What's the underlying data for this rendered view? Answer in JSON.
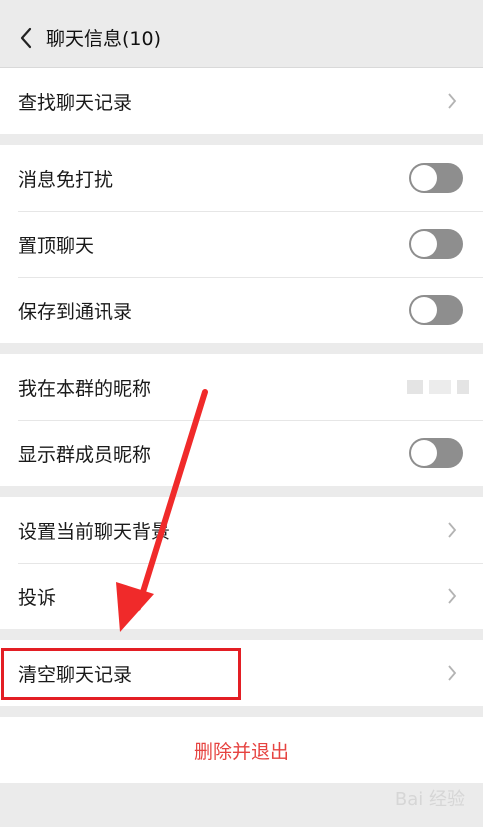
{
  "header": {
    "title": "聊天信息(10)"
  },
  "groups": [
    {
      "rows": [
        {
          "label": "查找聊天记录",
          "control": "chevron"
        }
      ]
    },
    {
      "rows": [
        {
          "label": "消息免打扰",
          "control": "toggle"
        },
        {
          "label": "置顶聊天",
          "control": "toggle"
        },
        {
          "label": "保存到通讯录",
          "control": "toggle"
        }
      ]
    },
    {
      "rows": [
        {
          "label": "我在本群的昵称",
          "control": "value"
        },
        {
          "label": "显示群成员昵称",
          "control": "toggle"
        }
      ]
    },
    {
      "rows": [
        {
          "label": "设置当前聊天背景",
          "control": "chevron"
        },
        {
          "label": "投诉",
          "control": "chevron"
        }
      ]
    },
    {
      "rows": [
        {
          "label": "清空聊天记录",
          "control": "chevron"
        }
      ]
    }
  ],
  "actions": {
    "delete_label": "删除并退出"
  },
  "colors": {
    "accent_red": "#e64340",
    "annotation_red": "#e31e24",
    "toggle_off": "#8e8e8e"
  },
  "watermark": "Bai 经验"
}
